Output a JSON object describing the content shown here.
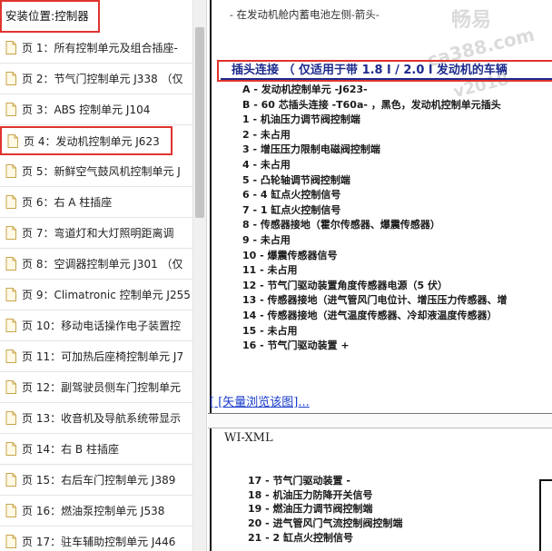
{
  "sidebar": {
    "header": "安装位置:控制器",
    "items": [
      {
        "label": "页 1：所有控制单元及组合插座-"
      },
      {
        "label": "页 2：节气门控制单元 J338 （仅"
      },
      {
        "label": "页 3：ABS 控制单元 J104"
      },
      {
        "label": "页 4：发动机控制单元 J623"
      },
      {
        "label": "页 5：新鲜空气鼓风机控制单元 J"
      },
      {
        "label": "页 6：右 A 柱插座"
      },
      {
        "label": "页 7：弯道灯和大灯照明距离调"
      },
      {
        "label": "页 8：空调器控制单元 J301 （仅"
      },
      {
        "label": "页 9：Climatronic 控制单元 J255"
      },
      {
        "label": "页 10：移动电话操作电子装置控"
      },
      {
        "label": "页 11：可加热后座椅控制单元 J7"
      },
      {
        "label": "页 12：副驾驶员侧车门控制单元"
      },
      {
        "label": "页 13：收音机及导航系统带显示"
      },
      {
        "label": "页 14：右 B 柱插座"
      },
      {
        "label": "页 15：右后车门控制单元 J389"
      },
      {
        "label": "页 16：燃油泵控制单元 J538"
      },
      {
        "label": "页 17：驻车辅助控制单元 J446"
      }
    ]
  },
  "doc": {
    "top_note": "- 在发动机舱内蓄电池左侧-箭头-",
    "watermark": [
      "畅易",
      "ca388.com",
      "v2018"
    ],
    "section_title": "插头连接 （ 仅适用于带 1.8 l / 2.0 l 发动机的车辆",
    "pins": [
      "A - 发动机控制单元 -J623-",
      "B - 60 芯插头连接 -T60a- ，黑色，发动机控制单元插头",
      "1 - 机油压力调节阀控制端",
      "2 - 未占用",
      "3 - 增压压力限制电磁阀控制端",
      "4 - 未占用",
      "5 - 凸轮轴调节阀控制端",
      "6 - 4 缸点火控制信号",
      "7 - 1 缸点火控制信号",
      "8 - 传感器接地（霍尔传感器、爆震传感器）",
      "9 - 未占用",
      "10 - 爆震传感器信号",
      "11 - 未占用",
      "12 - 节气门驱动装置角度传感器电源（5 伏）",
      "13 - 传感器接地（进气管风门电位计、增压压力传感器、增",
      "14 - 传感器接地（进气温度传感器、冷却液温度传感器）",
      "15 - 未占用",
      "16 - 节气门驱动装置 +"
    ],
    "vector_link": "[ [矢量浏览该图]...",
    "wi_xml": "WI-XML",
    "pins2": [
      "17 - 节气门驱动装置 -",
      "18 - 机油压力防降开关信号",
      "19 - 燃油压力调节阀控制端",
      "20 - 进气管风门气流控制阀控制端",
      "21 - 2 缸点火控制信号"
    ]
  }
}
